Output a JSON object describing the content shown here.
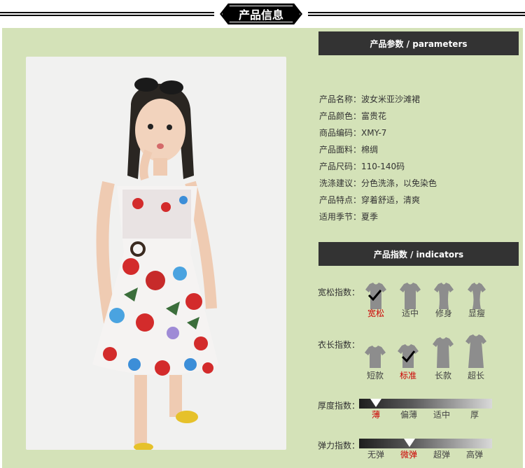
{
  "header": {
    "title": "产品信息"
  },
  "parameters": {
    "heading": "产品参数 / parameters",
    "rows": [
      "产品名称：波女米亚沙滩裙",
      "产品颜色：富贵花",
      "商品编码：XMY-7",
      "产品面料：棉绸",
      "产品尺码：110-140码",
      "洗涤建议：分色洗涤，以免染色",
      "产品特点：穿着舒适，清爽",
      "适用季节：夏季"
    ]
  },
  "indicators": {
    "heading": "产品指数 / indicators",
    "looseness": {
      "label": "宽松指数：",
      "options": [
        "宽松",
        "适中",
        "修身",
        "显瘦"
      ],
      "selected": "宽松"
    },
    "length": {
      "label": "衣长指数：",
      "options": [
        "短款",
        "标准",
        "长款",
        "超长"
      ],
      "selected": "标准"
    },
    "thickness": {
      "label": "厚度指数：",
      "options": [
        "薄",
        "偏薄",
        "适中",
        "厚"
      ],
      "selected": "薄"
    },
    "elasticity": {
      "label": "弹力指数：",
      "options": [
        "无弹",
        "微弹",
        "超弹",
        "高弹"
      ],
      "selected": "微弹"
    }
  },
  "colors": {
    "accent": "#cc0000",
    "panel": "#d4e2b8",
    "bar": "#333333"
  }
}
